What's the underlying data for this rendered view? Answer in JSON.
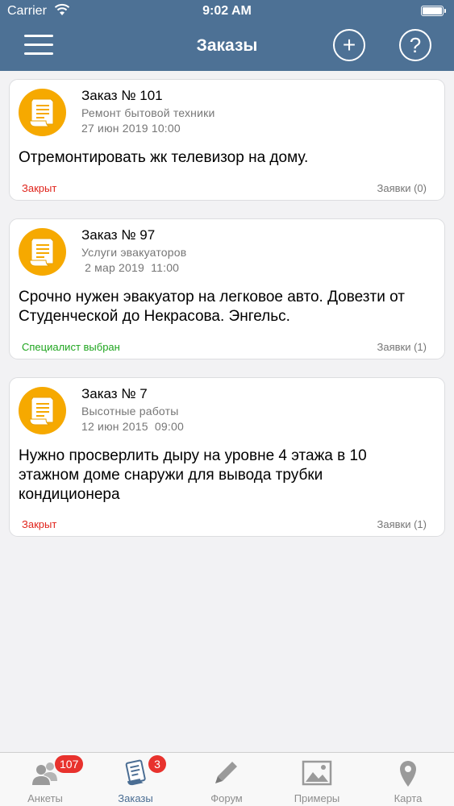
{
  "status_bar": {
    "carrier": "Carrier",
    "time": "9:02 AM"
  },
  "header": {
    "title": "Заказы",
    "add_icon": "plus-circle",
    "help_icon": "question-circle"
  },
  "orders": [
    {
      "number": "Заказ № 101",
      "category": "Ремонт бытовой техники",
      "date": "27 июн 2019  10:00",
      "description": "Отремонтировать жк телевизор на дому.",
      "status": "Закрыт",
      "status_color": "#e0241c",
      "requests": "Заявки (0)"
    },
    {
      "number": "Заказ № 97",
      "category": "Услуги эвакуаторов",
      "date": " 2 мар 2019  11:00",
      "description": "Срочно нужен эвакуатор на легковое авто. Довезти от Студенческой до Некрасова. Энгельс.",
      "status": "Специалист выбран",
      "status_color": "#1fa51f",
      "requests": "Заявки (1)"
    },
    {
      "number": "Заказ № 7",
      "category": "Высотные работы",
      "date": "12 июн 2015  09:00",
      "description": "Нужно просверлить дыру на уровне 4 этажа в 10 этажном доме снаружи для вывода трубки кондиционера",
      "status": "Закрыт",
      "status_color": "#e0241c",
      "requests": "Заявки (1)"
    }
  ],
  "tabbar": {
    "tabs": [
      {
        "label": "Анкеты",
        "icon": "people-icon",
        "badge": "107"
      },
      {
        "label": "Заказы",
        "icon": "orders-icon",
        "badge": "3",
        "active": true
      },
      {
        "label": "Форум",
        "icon": "pencil-icon"
      },
      {
        "label": "Примеры",
        "icon": "image-icon"
      },
      {
        "label": "Карта",
        "icon": "map-pin-icon"
      }
    ]
  },
  "colors": {
    "header_bg": "#4d7195",
    "accent_orange": "#f6a900",
    "badge_red": "#e8322d"
  }
}
